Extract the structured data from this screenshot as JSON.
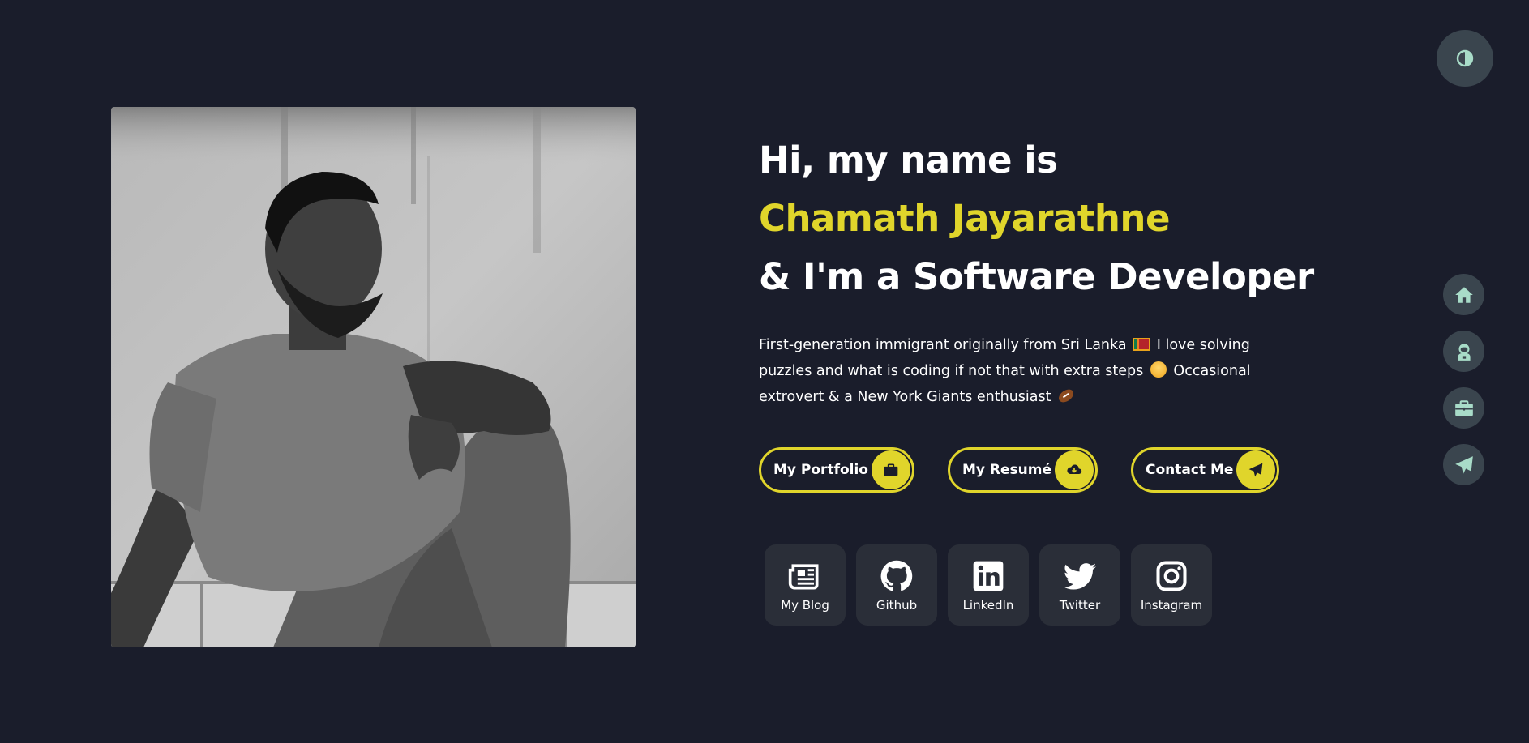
{
  "hero": {
    "greeting": "Hi, my name is",
    "name": "Chamath Jayarathne",
    "role_line": "& I'm a Software Developer",
    "bio_part1": "First-generation immigrant originally from Sri Lanka",
    "bio_part2": "I love solving puzzles and what is coding if not that with extra steps",
    "bio_part3": "Occasional extrovert & a New York Giants enthusiast"
  },
  "actions": [
    {
      "label": "My Portfolio",
      "icon": "briefcase-icon"
    },
    {
      "label": "My Resumé",
      "icon": "cloud-download-icon"
    },
    {
      "label": "Contact Me",
      "icon": "paper-plane-icon"
    }
  ],
  "socials": [
    {
      "label": "My Blog",
      "icon": "newspaper-icon"
    },
    {
      "label": "Github",
      "icon": "github-icon"
    },
    {
      "label": "LinkedIn",
      "icon": "linkedin-icon"
    },
    {
      "label": "Twitter",
      "icon": "twitter-icon"
    },
    {
      "label": "Instagram",
      "icon": "instagram-icon"
    }
  ],
  "sidenav": [
    {
      "icon": "home-icon"
    },
    {
      "icon": "astronaut-icon"
    },
    {
      "icon": "briefcase-icon"
    },
    {
      "icon": "paper-plane-icon"
    }
  ],
  "theme_toggle": {
    "icon": "contrast-icon"
  },
  "colors": {
    "background": "#1a1d2b",
    "accent": "#e0d52b",
    "card": "#2a2e38",
    "nav_button": "#3a454e",
    "nav_icon": "#a8dcc8"
  }
}
